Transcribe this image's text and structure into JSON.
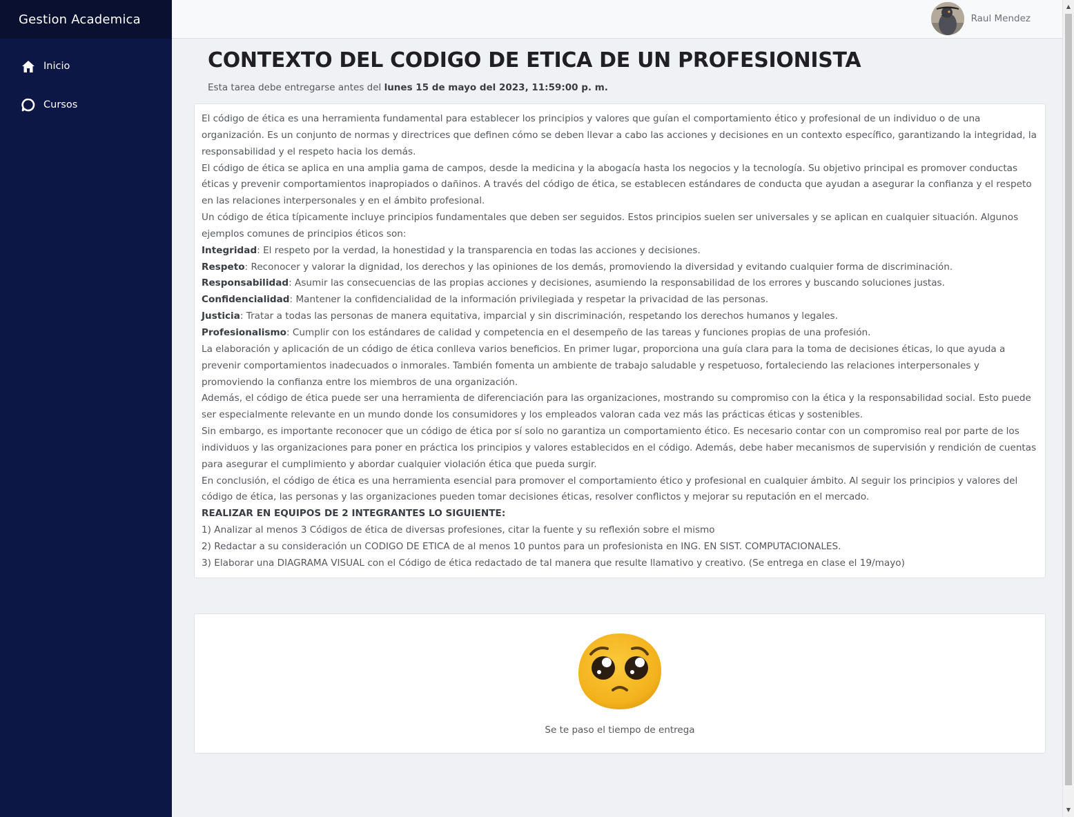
{
  "app": {
    "title": "Gestion Academica"
  },
  "sidebar": {
    "items": [
      {
        "label": "Inicio",
        "icon": "home-icon"
      },
      {
        "label": "Cursos",
        "icon": "chat-bubble-icon"
      }
    ]
  },
  "user": {
    "name": "Raul Mendez"
  },
  "assignment": {
    "title": "CONTEXTO DEL CODIGO DE ETICA DE UN PROFESIONISTA",
    "deadline_prefix": "Esta tarea debe entregarse antes del ",
    "deadline_date": "lunes 15 de mayo del 2023, 11:59:00 p. m.",
    "paragraphs": [
      "El código de ética es una herramienta fundamental para establecer los principios y valores que guían el comportamiento ético y profesional de un individuo o de una organización. Es un conjunto de normas y directrices que definen cómo se deben llevar a cabo las acciones y decisiones en un contexto específico, garantizando la integridad, la responsabilidad y el respeto hacia los demás.",
      "El código de ética se aplica en una amplia gama de campos, desde la medicina y la abogacía hasta los negocios y la tecnología. Su objetivo principal es promover conductas éticas y prevenir comportamientos inapropiados o dañinos. A través del código de ética, se establecen estándares de conducta que ayudan a asegurar la confianza y el respeto en las relaciones interpersonales y en el ámbito profesional.",
      "Un código de ética típicamente incluye principios fundamentales que deben ser seguidos. Estos principios suelen ser universales y se aplican en cualquier situación. Algunos ejemplos comunes de principios éticos son:"
    ],
    "principles": [
      {
        "term": "Integridad",
        "text": ": El respeto por la verdad, la honestidad y la transparencia en todas las acciones y decisiones."
      },
      {
        "term": "Respeto",
        "text": ": Reconocer y valorar la dignidad, los derechos y las opiniones de los demás, promoviendo la diversidad y evitando cualquier forma de discriminación."
      },
      {
        "term": "Responsabilidad",
        "text": ": Asumir las consecuencias de las propias acciones y decisiones, asumiendo la responsabilidad de los errores y buscando soluciones justas."
      },
      {
        "term": "Confidencialidad",
        "text": ": Mantener la confidencialidad de la información privilegiada y respetar la privacidad de las personas."
      },
      {
        "term": "Justicia",
        "text": ": Tratar a todas las personas de manera equitativa, imparcial y sin discriminación, respetando los derechos humanos y legales."
      },
      {
        "term": "Profesionalismo",
        "text": ": Cumplir con los estándares de calidad y competencia en el desempeño de las tareas y funciones propias de una profesión."
      }
    ],
    "closing_paragraphs": [
      "La elaboración y aplicación de un código de ética conlleva varios beneficios. En primer lugar, proporciona una guía clara para la toma de decisiones éticas, lo que ayuda a prevenir comportamientos inadecuados o inmorales. También fomenta un ambiente de trabajo saludable y respetuoso, fortaleciendo las relaciones interpersonales y promoviendo la confianza entre los miembros de una organización.",
      "Además, el código de ética puede ser una herramienta de diferenciación para las organizaciones, mostrando su compromiso con la ética y la responsabilidad social. Esto puede ser especialmente relevante en un mundo donde los consumidores y los empleados valoran cada vez más las prácticas éticas y sostenibles.",
      "Sin embargo, es importante reconocer que un código de ética por sí solo no garantiza un comportamiento ético. Es necesario contar con un compromiso real por parte de los individuos y las organizaciones para poner en práctica los principios y valores establecidos en el código. Además, debe haber mecanismos de supervisión y rendición de cuentas para asegurar el cumplimiento y abordar cualquier violación ética que pueda surgir.",
      "En conclusión, el código de ética es una herramienta esencial para promover el comportamiento ético y profesional en cualquier ámbito. Al seguir los principios y valores del código de ética, las personas y las organizaciones pueden tomar decisiones éticas, resolver conflictos y mejorar su reputación en el mercado."
    ],
    "instructions_heading": "REALIZAR EN EQUIPOS DE 2 INTEGRANTES LO SIGUIENTE:",
    "instructions": [
      "1)   Analizar al menos 3 Códigos de ética de diversas profesiones, citar la fuente y su reflexión sobre el mismo",
      "2)   Redactar a su consideración un CODIGO DE ETICA de al menos 10 puntos para un profesionista en ING. EN SIST. COMPUTACIONALES.",
      "3)   Elaborar una DIAGRAMA VISUAL con el Código de ética redactado de tal manera que resulte llamativo y creativo. (Se entrega en clase el 19/mayo)"
    ]
  },
  "submission": {
    "status_text": "Se te paso el tiempo de entrega",
    "status_icon": "pleading-face-icon"
  },
  "colors": {
    "sidebar_bg": "#0d1746",
    "sidebar_header_bg": "#0a1030",
    "page_bg": "#f0f1f5",
    "emoji_yellow": "#f5b81d"
  }
}
